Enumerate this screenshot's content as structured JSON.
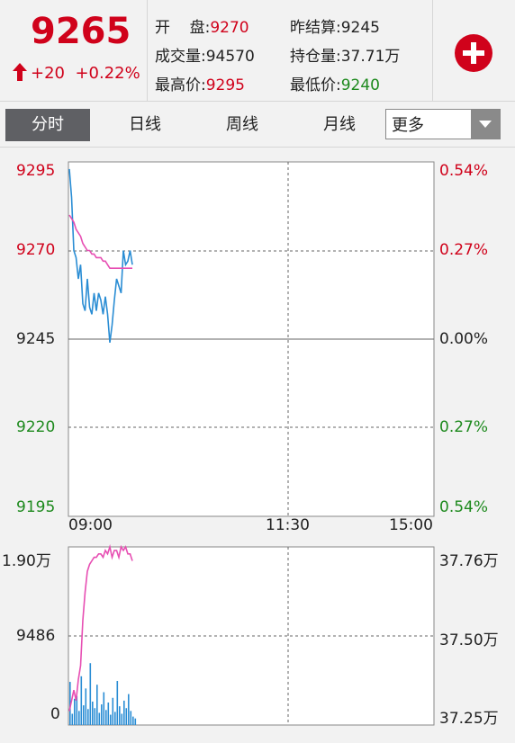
{
  "header": {
    "price": "9265",
    "change": "+20",
    "change_pct": "+0.22%",
    "stats": {
      "open_label": "开    盘:",
      "open_value": "9270",
      "prev_settle_label": "昨结算:",
      "prev_settle_value": "9245",
      "volume_label": "成交量:",
      "volume_value": "94570",
      "open_interest_label": "持仓量:",
      "open_interest_value": "37.71万",
      "high_label": "最高价:",
      "high_value": "9295",
      "low_label": "最低价:",
      "low_value": "9240"
    },
    "add_icon": "plus-circle-icon"
  },
  "tabs": {
    "items": [
      "分时",
      "日线",
      "周线",
      "月线"
    ],
    "active": "分时",
    "more": "更多"
  },
  "chart_data": [
    {
      "type": "line",
      "title": "",
      "y_left_ticks": [
        "9295",
        "9270",
        "9245",
        "9220",
        "9195"
      ],
      "y_right_ticks": [
        "0.54%",
        "0.27%",
        "0.00%",
        "0.27%",
        "0.54%"
      ],
      "x_ticks": [
        "09:00",
        "11:30",
        "15:00"
      ],
      "ylim": [
        9195,
        9295
      ],
      "series": [
        {
          "values": [
            9293,
            9285,
            9270,
            9268,
            9262,
            9266,
            9255,
            9253,
            9262,
            9254,
            9252,
            9258,
            9253,
            9258,
            9256,
            9252,
            9257,
            9252,
            9244,
            9249,
            9256,
            9262,
            9260,
            9258,
            9270,
            9266,
            9267,
            9270,
            9266
          ]
        },
        {
          "values": [
            9280,
            9279,
            9278,
            9276,
            9275,
            9274,
            9272,
            9271,
            9270,
            9270,
            9269,
            9269,
            9268,
            9268,
            9268,
            9267,
            9267,
            9266,
            9265,
            9265,
            9265,
            9265,
            9265,
            9265,
            9265,
            9265,
            9265,
            9265,
            9265
          ]
        }
      ]
    },
    {
      "type": "bar",
      "y_left_ticks": [
        "1.90万",
        "9486",
        "0"
      ],
      "y_right_ticks": [
        "37.76万",
        "37.50万",
        "37.25万"
      ],
      "series": [
        {
          "values": [
            4600,
            1200,
            2800,
            3100,
            1500,
            5200,
            2100,
            3900,
            1700,
            6600,
            2500,
            1800,
            4300,
            1300,
            2200,
            3500,
            1600,
            2400,
            1100,
            2900,
            1400,
            4700,
            2000,
            1200,
            2600,
            1800,
            3300,
            1500,
            900,
            700
          ]
        },
        {
          "values": [
            37.29,
            37.32,
            37.35,
            37.32,
            37.38,
            37.42,
            37.55,
            37.63,
            37.69,
            37.71,
            37.72,
            37.73,
            37.73,
            37.74,
            37.74,
            37.73,
            37.75,
            37.74,
            37.76,
            37.73,
            37.75,
            37.75,
            37.73,
            37.76,
            37.75,
            37.76,
            37.74,
            37.74,
            37.72
          ]
        }
      ]
    }
  ]
}
